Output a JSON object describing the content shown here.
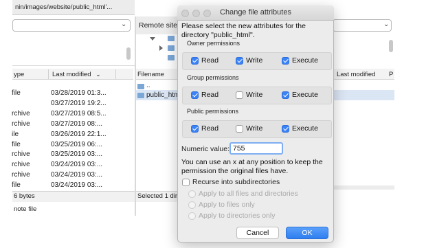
{
  "left_pane": {
    "path": "nin/images/website/public_html'...",
    "columns": [
      "ype",
      "Last modified"
    ],
    "rows": [
      {
        "type": "file",
        "modified": "03/28/2019 01:3..."
      },
      {
        "type": "",
        "modified": "03/27/2019 19:2..."
      },
      {
        "type": "rchive",
        "modified": "03/27/2019 08:5..."
      },
      {
        "type": "rchive",
        "modified": "03/27/2019 08:..."
      },
      {
        "type": "ile",
        "modified": "03/26/2019 22:1..."
      },
      {
        "type": "file",
        "modified": "03/25/2019 06:..."
      },
      {
        "type": "rchive",
        "modified": "03/25/2019 03:..."
      },
      {
        "type": "rchive",
        "modified": "03/24/2019 03:..."
      },
      {
        "type": "rchive",
        "modified": "03/24/2019 03:..."
      },
      {
        "type": "file",
        "modified": "03/24/2019 03:..."
      }
    ],
    "status": "6 bytes",
    "bottom_label": "note file"
  },
  "right_pane": {
    "site_label": "Remote site:",
    "column_name": "Filename",
    "rows": [
      "..",
      "public_htm"
    ],
    "status": "Selected 1 dire",
    "extra_columns": [
      "Last modified",
      "P"
    ]
  },
  "dialog": {
    "title": "Change file attributes",
    "prompt": "Please select the new attributes for the directory \"public_html\".",
    "groups": [
      {
        "title": "Owner permissions",
        "read": {
          "label": "Read",
          "checked": true
        },
        "write": {
          "label": "Write",
          "checked": true
        },
        "execute": {
          "label": "Execute",
          "checked": true
        }
      },
      {
        "title": "Group permissions",
        "read": {
          "label": "Read",
          "checked": true
        },
        "write": {
          "label": "Write",
          "checked": false
        },
        "execute": {
          "label": "Execute",
          "checked": true
        }
      },
      {
        "title": "Public permissions",
        "read": {
          "label": "Read",
          "checked": true
        },
        "write": {
          "label": "Write",
          "checked": false
        },
        "execute": {
          "label": "Execute",
          "checked": true
        }
      }
    ],
    "numeric_label": "Numeric value:",
    "numeric_value": "755",
    "hint": "You can use an x at any position to keep the permission the original files have.",
    "recurse": {
      "label": "Recurse into subdirectories",
      "checked": false
    },
    "apply_options": [
      "Apply to all files and directories",
      "Apply to files only",
      "Apply to directories only"
    ],
    "cancel_label": "Cancel",
    "ok_label": "OK"
  },
  "colors": {
    "accent": "#3b82f6",
    "selection": "#dbe6f4",
    "dialog_bg": "#ececec"
  }
}
